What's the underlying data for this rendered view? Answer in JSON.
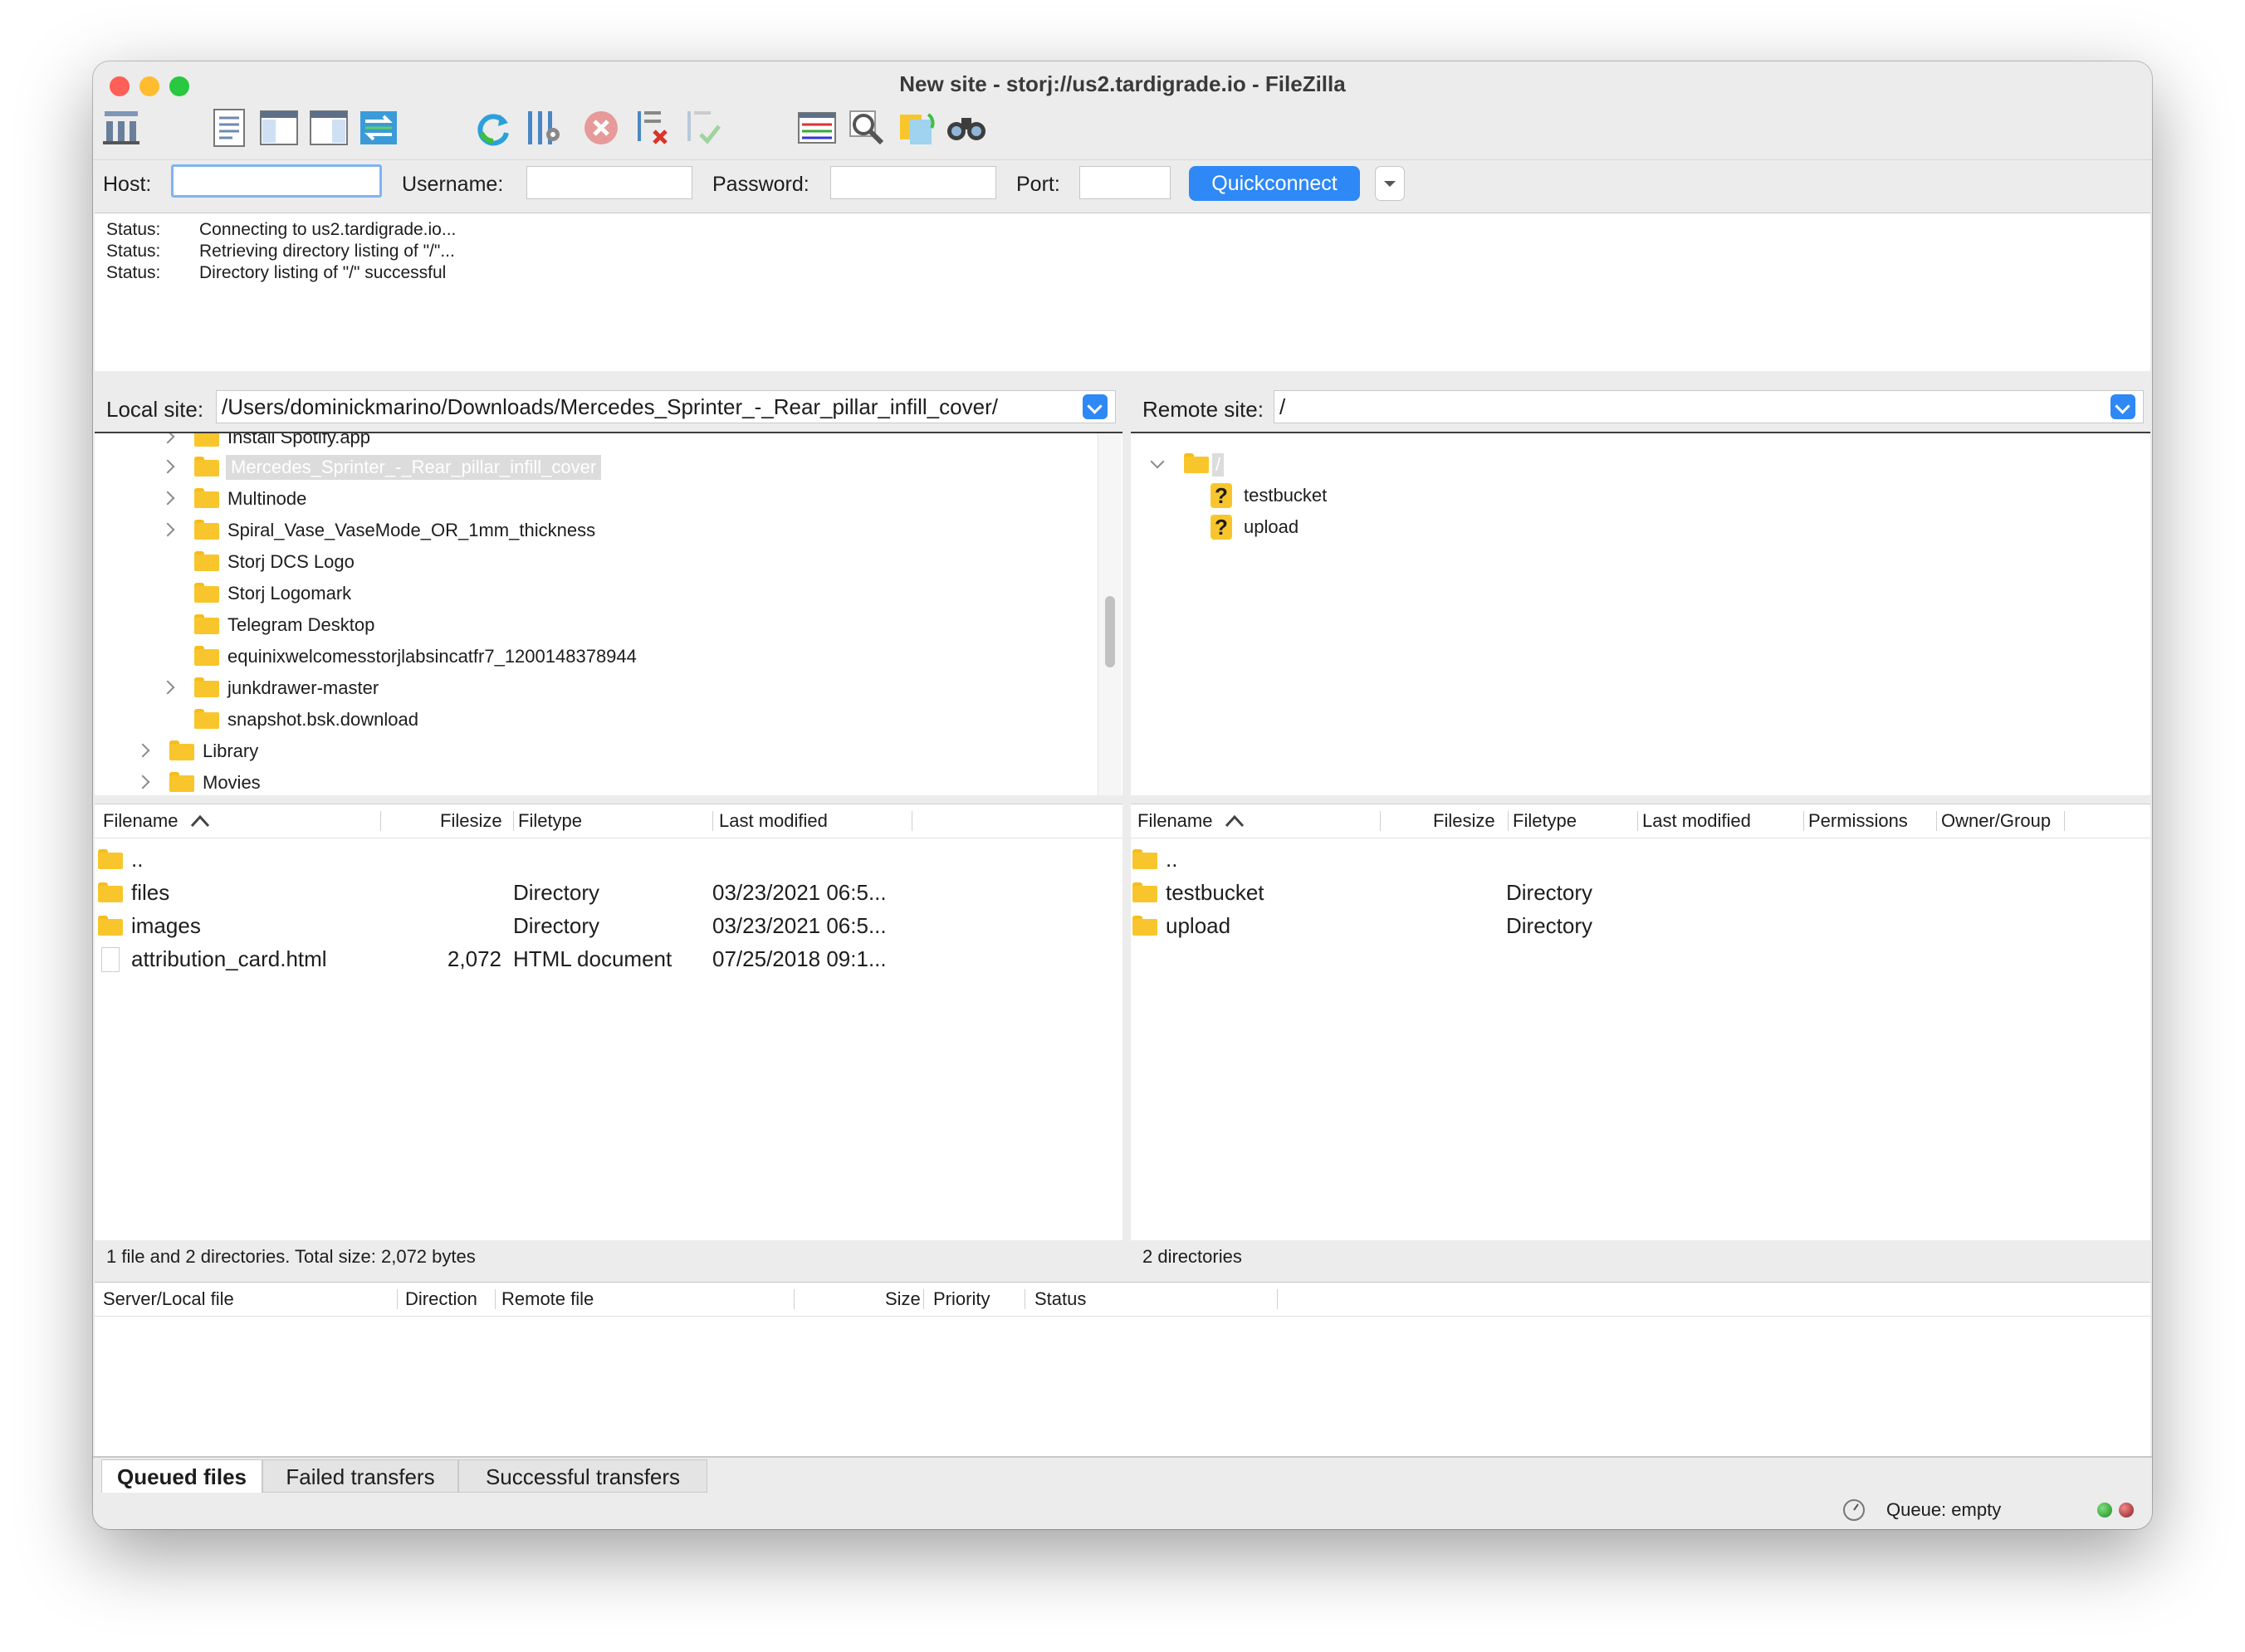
{
  "window": {
    "title": "New site - storj://us2.tardigrade.io - FileZilla"
  },
  "toolbar": {
    "icons": [
      "site-manager-icon",
      "toggle-message-log-icon",
      "toggle-local-tree-icon",
      "toggle-remote-tree-icon",
      "toggle-transfer-queue-icon",
      "refresh-icon",
      "process-queue-icon",
      "cancel-icon",
      "disconnect-icon",
      "reconnect-icon",
      "directory-filter-icon",
      "search-icon",
      "compare-icon",
      "find-files-icon"
    ]
  },
  "quickconnect": {
    "host_label": "Host:",
    "host_value": "",
    "username_label": "Username:",
    "username_value": "",
    "password_label": "Password:",
    "password_value": "",
    "port_label": "Port:",
    "port_value": "",
    "button_label": "Quickconnect"
  },
  "log": [
    {
      "key": "Status:",
      "msg": "Connecting to us2.tardigrade.io..."
    },
    {
      "key": "Status:",
      "msg": "Retrieving directory listing of \"/\"..."
    },
    {
      "key": "Status:",
      "msg": "Directory listing of \"/\" successful"
    }
  ],
  "local": {
    "label": "Local site:",
    "path": "/Users/dominickmarino/Downloads/Mercedes_Sprinter_-_Rear_pillar_infill_cover/",
    "tree": [
      {
        "name": "Install Spotify.app",
        "expand": true
      },
      {
        "name": "Mercedes_Sprinter_-_Rear_pillar_infill_cover",
        "expand": true,
        "selected": true
      },
      {
        "name": "Multinode",
        "expand": true
      },
      {
        "name": "Spiral_Vase_VaseMode_OR_1mm_thickness",
        "expand": true
      },
      {
        "name": "Storj DCS Logo",
        "expand": false
      },
      {
        "name": "Storj Logomark",
        "expand": false
      },
      {
        "name": "Telegram Desktop",
        "expand": false
      },
      {
        "name": "equinixwelcomesstorjlabsincatfr7_1200148378944",
        "expand": false
      },
      {
        "name": "junkdrawer-master",
        "expand": true
      },
      {
        "name": "snapshot.bsk.download",
        "expand": false
      },
      {
        "name": "Library",
        "expand": true
      },
      {
        "name": "Movies",
        "expand": true
      }
    ],
    "columns": {
      "filename": "Filename",
      "filesize": "Filesize",
      "filetype": "Filetype",
      "modified": "Last modified"
    },
    "files": [
      {
        "name": "..",
        "size": "",
        "type": "",
        "modified": ""
      },
      {
        "name": "files",
        "size": "",
        "type": "Directory",
        "modified": "03/23/2021 06:5..."
      },
      {
        "name": "images",
        "size": "",
        "type": "Directory",
        "modified": "03/23/2021 06:5..."
      },
      {
        "name": "attribution_card.html",
        "size": "2,072",
        "type": "HTML document",
        "modified": "07/25/2018 09:1..."
      }
    ],
    "status": "1 file and 2 directories. Total size: 2,072 bytes"
  },
  "remote": {
    "label": "Remote site:",
    "path": "/",
    "tree_root": "/",
    "tree": [
      {
        "name": "testbucket"
      },
      {
        "name": "upload"
      }
    ],
    "columns": {
      "filename": "Filename",
      "filesize": "Filesize",
      "filetype": "Filetype",
      "modified": "Last modified",
      "permissions": "Permissions",
      "owner": "Owner/Group"
    },
    "files": [
      {
        "name": "..",
        "type": ""
      },
      {
        "name": "testbucket",
        "type": "Directory"
      },
      {
        "name": "upload",
        "type": "Directory"
      }
    ],
    "status": "2 directories"
  },
  "queue": {
    "columns": {
      "server": "Server/Local file",
      "direction": "Direction",
      "remote": "Remote file",
      "size": "Size",
      "priority": "Priority",
      "status": "Status"
    },
    "tabs": [
      "Queued files",
      "Failed transfers",
      "Successful transfers"
    ],
    "status": "Queue: empty"
  },
  "colors": {
    "accent": "#2e88f5",
    "folder": "#f8c62c",
    "selection": "#dcdcdc"
  }
}
